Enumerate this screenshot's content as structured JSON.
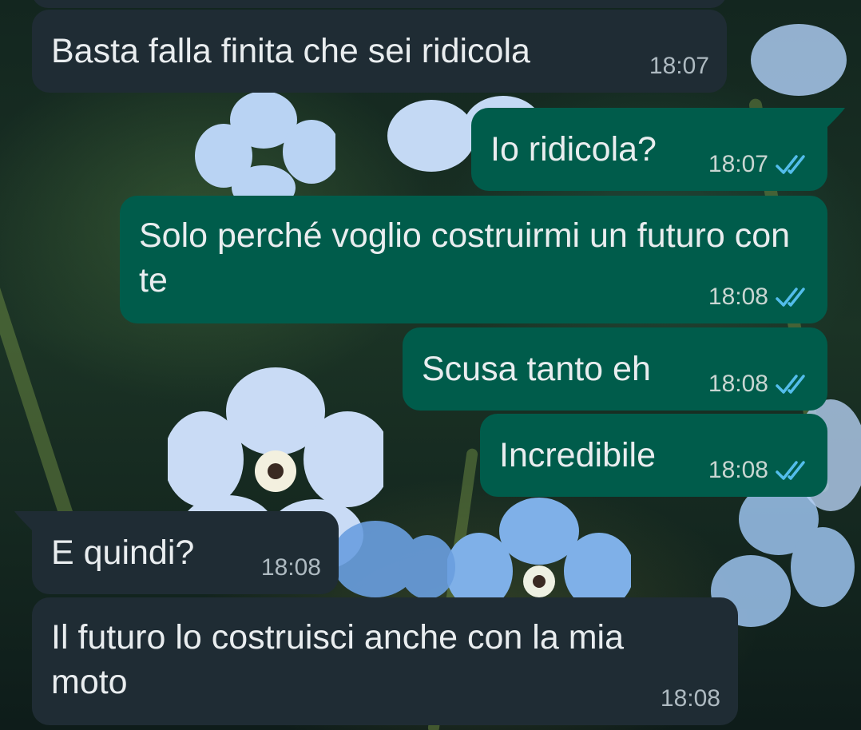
{
  "colors": {
    "incoming_bubble": "#1f2c34",
    "outgoing_bubble": "#005c4b",
    "read_ticks": "#53bdeb",
    "text": "#e9edef"
  },
  "messages": [
    {
      "direction": "incoming",
      "text": "Basta falla finita che sei ridicola",
      "time": "18:07"
    },
    {
      "direction": "outgoing",
      "text": "Io ridicola?",
      "time": "18:07",
      "status": "read-double-check-icon"
    },
    {
      "direction": "outgoing",
      "text": "Solo perché voglio costruirmi un futuro con te",
      "time": "18:08",
      "status": "read-double-check-icon"
    },
    {
      "direction": "outgoing",
      "text": "Scusa tanto eh",
      "time": "18:08",
      "status": "read-double-check-icon"
    },
    {
      "direction": "outgoing",
      "text": "Incredibile",
      "time": "18:08",
      "status": "read-double-check-icon"
    },
    {
      "direction": "incoming",
      "text": "E quindi?",
      "time": "18:08"
    },
    {
      "direction": "incoming",
      "text": "Il futuro lo costruisci anche con la mia moto",
      "time": "18:08"
    }
  ]
}
